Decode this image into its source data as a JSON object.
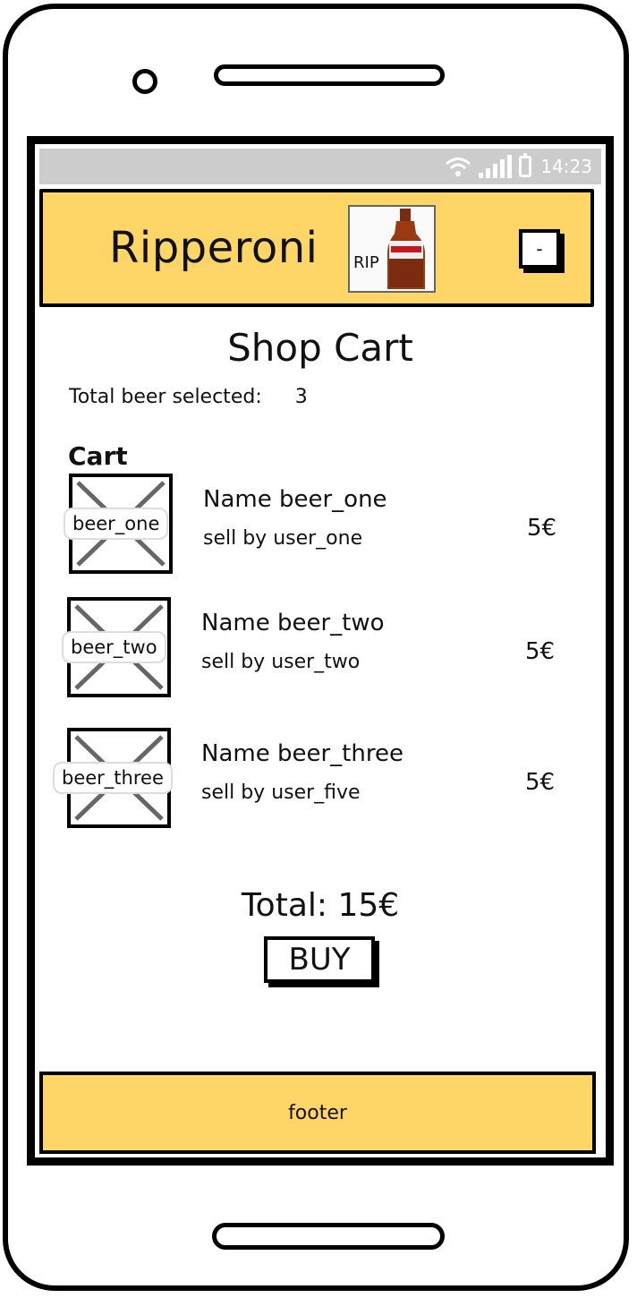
{
  "status_bar": {
    "time": "14:23",
    "icons": [
      "wifi-icon",
      "signal-icon",
      "battery-icon"
    ]
  },
  "header": {
    "title": "Ripperoni",
    "logo_text": "RIP",
    "menu_label": "-"
  },
  "page": {
    "title": "Shop Cart",
    "total_selected_label": "Total beer selected:",
    "total_selected_value": "3",
    "cart_heading": "Cart"
  },
  "cart": {
    "items": [
      {
        "image_label": "beer_one",
        "name": "Name beer_one",
        "seller": "sell by user_one",
        "price": "5€"
      },
      {
        "image_label": "beer_two",
        "name": "Name beer_two",
        "seller": "sell by user_two",
        "price": "5€"
      },
      {
        "image_label": "beer_three",
        "name": "Name beer_three",
        "seller": "sell by user_five",
        "price": "5€"
      }
    ],
    "total": "Total: 15€",
    "buy_label": "BUY"
  },
  "footer": {
    "label": "footer"
  },
  "colors": {
    "accent": "#fdd667",
    "status_bar": "#cccccc"
  }
}
